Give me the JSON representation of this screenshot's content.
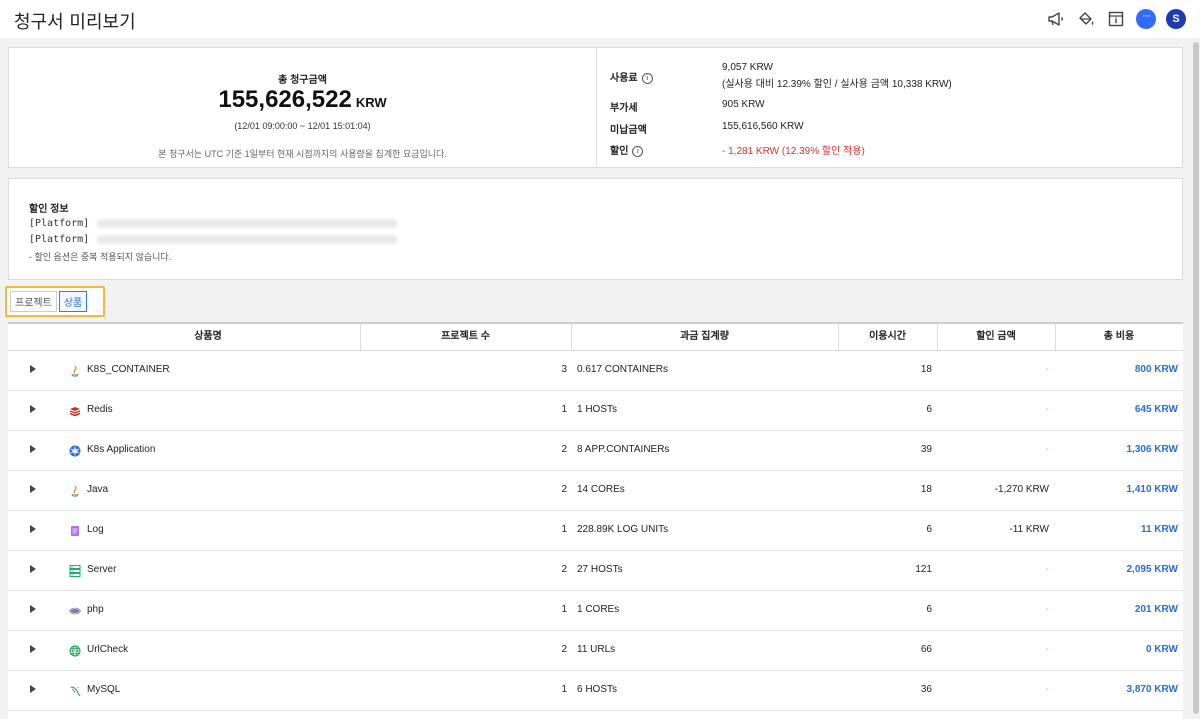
{
  "header": {
    "title": "청구서 미리보기",
    "avatar_letter": "S",
    "chat_dots": "···",
    "icons": [
      "megaphone-icon",
      "paint-bucket-icon",
      "document-icon",
      "chat-icon",
      "avatar"
    ]
  },
  "summary": {
    "total_label": "총 청구금액",
    "total_amount": "155,626,522",
    "currency": "KRW",
    "period": "(12/01 09:00:00 ~ 12/01 15:01:04)",
    "note": "본 청구서는 UTC 기준 1일부터 현재 시점까지의 사용량을 집계한 요금입니다.",
    "details": {
      "usage_label": "사용료",
      "usage_value": "9,057 KRW",
      "usage_sub": "(실사용 대비 12.39% 할인 / 실사용 금액 10,338 KRW)",
      "vat_label": "부가세",
      "vat_value": "905 KRW",
      "unpaid_label": "미납금액",
      "unpaid_value": "155,616,560 KRW",
      "discount_label": "할인",
      "discount_value": "- 1,281 KRW  (12.39% 할인 적용)"
    },
    "info_glyph": "i"
  },
  "discount_info": {
    "title": "할인 정보",
    "lines": [
      "[Platform]",
      "[Platform]"
    ],
    "footnote": "- 할인 옵션은 중복 적용되지 않습니다."
  },
  "tabs": [
    {
      "label": "프로젝트",
      "active": false
    },
    {
      "label": "상품",
      "active": true
    }
  ],
  "table": {
    "columns": [
      "상품명",
      "프로젝트 수",
      "과금 집계량",
      "이용시간",
      "할인 금액",
      "총 비용"
    ],
    "rows": [
      {
        "icon": "java-icon",
        "name": "K8S_CONTAINER",
        "projects": "3",
        "aggregate": "0.617 CONTAINERs",
        "hours": "18",
        "discount": "-",
        "total": "800 KRW"
      },
      {
        "icon": "redis-icon",
        "name": "Redis",
        "projects": "1",
        "aggregate": "1 HOSTs",
        "hours": "6",
        "discount": "-",
        "total": "645 KRW"
      },
      {
        "icon": "kubernetes-icon",
        "name": "K8s Application",
        "projects": "2",
        "aggregate": "8 APP.CONTAINERs",
        "hours": "39",
        "discount": "-",
        "total": "1,306 KRW"
      },
      {
        "icon": "java-icon",
        "name": "Java",
        "projects": "2",
        "aggregate": "14 COREs",
        "hours": "18",
        "discount": "-1,270 KRW",
        "total": "1,410 KRW"
      },
      {
        "icon": "log-icon",
        "name": "Log",
        "projects": "1",
        "aggregate": "228.89K LOG UNITs",
        "hours": "6",
        "discount": "-11 KRW",
        "total": "11 KRW"
      },
      {
        "icon": "server-icon",
        "name": "Server",
        "projects": "2",
        "aggregate": "27 HOSTs",
        "hours": "121",
        "discount": "-",
        "total": "2,095 KRW"
      },
      {
        "icon": "php-icon",
        "name": "php",
        "projects": "1",
        "aggregate": "1 COREs",
        "hours": "6",
        "discount": "-",
        "total": "201 KRW"
      },
      {
        "icon": "globe-icon",
        "name": "UrlCheck",
        "projects": "2",
        "aggregate": "11 URLs",
        "hours": "66",
        "discount": "-",
        "total": "0 KRW"
      },
      {
        "icon": "mysql-icon",
        "name": "MySQL",
        "projects": "1",
        "aggregate": "6 HOSTs",
        "hours": "36",
        "discount": "-",
        "total": "3,870 KRW"
      }
    ]
  },
  "colors": {
    "accent": "#2a6cd4",
    "highlight_border": "#f5b93c",
    "discount_red": "#e03030",
    "avatar": "#1f3bb3"
  }
}
